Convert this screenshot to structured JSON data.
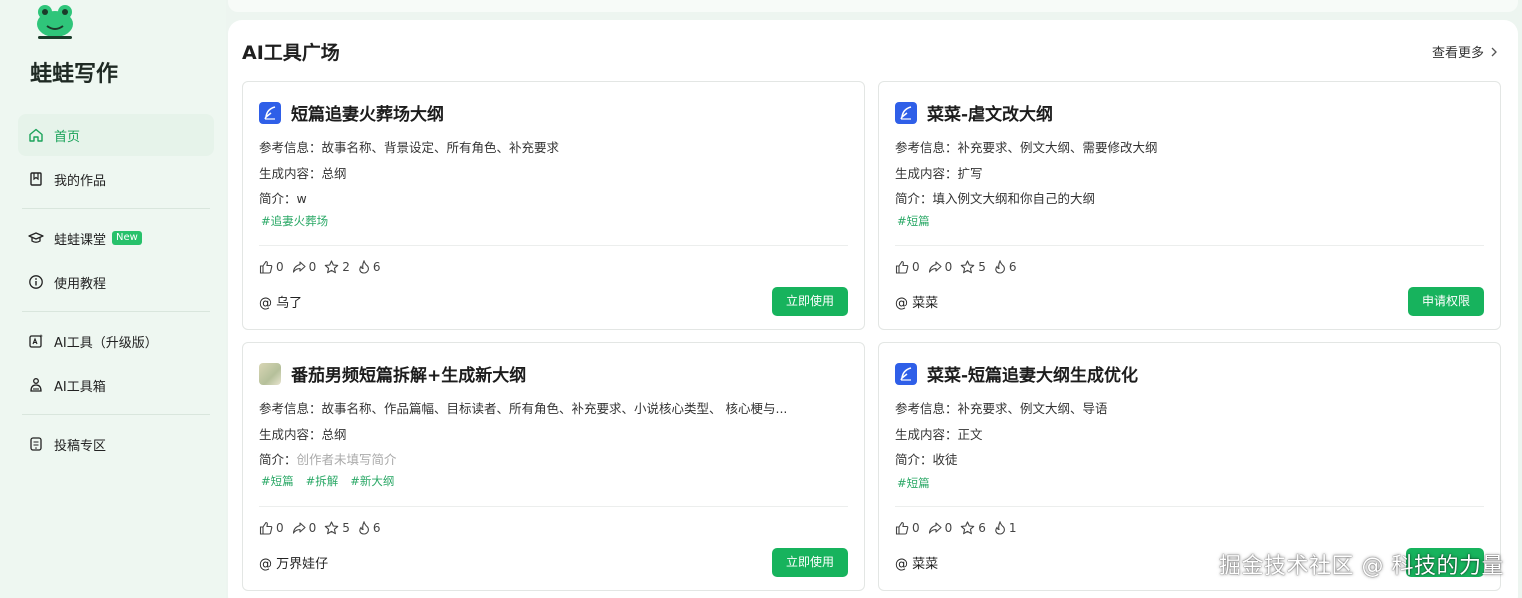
{
  "sidebar": {
    "brand": "蛙蛙写作",
    "items": [
      {
        "label": "首页",
        "active": true
      },
      {
        "label": "我的作品"
      },
      {
        "label": "蛙蛙课堂",
        "badge": "New"
      },
      {
        "label": "使用教程"
      },
      {
        "label": "AI工具（升级版）"
      },
      {
        "label": "AI工具箱"
      },
      {
        "label": "投稿专区"
      }
    ]
  },
  "main": {
    "title": "AI工具广场",
    "see_more": "查看更多"
  },
  "cards": [
    {
      "title": "短篇追妻火葬场大纲",
      "ref": "参考信息：故事名称、背景设定、所有角色、补充要求",
      "gen": "生成内容：总纲",
      "intro_label": "简介：",
      "intro": "w",
      "tags": [
        "#追妻火葬场"
      ],
      "likes": "0",
      "shares": "0",
      "stars": "2",
      "uses": "6",
      "author": "@ 乌了",
      "button": "立即使用"
    },
    {
      "title": "菜菜-虐文改大纲",
      "ref": "参考信息：补充要求、例文大纲、需要修改大纲",
      "gen": "生成内容：扩写",
      "intro_label": "简介：",
      "intro": "填入例文大纲和你自己的大纲",
      "tags": [
        "#短篇"
      ],
      "likes": "0",
      "shares": "0",
      "stars": "5",
      "uses": "6",
      "author": "@ 菜菜",
      "button": "申请权限"
    },
    {
      "title": "番茄男频短篇拆解+生成新大纲",
      "ref": "参考信息：故事名称、作品篇幅、目标读者、所有角色、补充要求、小说核心类型、 核心梗与...",
      "gen": "生成内容：总纲",
      "intro_label": "简介：",
      "intro": "创作者未填写简介",
      "tags": [
        "#短篇",
        "#拆解",
        "#新大纲"
      ],
      "likes": "0",
      "shares": "0",
      "stars": "5",
      "uses": "6",
      "author": "@ 万界娃仔",
      "button": "立即使用"
    },
    {
      "title": "菜菜-短篇追妻大纲生成优化",
      "ref": "参考信息：补充要求、例文大纲、导语",
      "gen": "生成内容：正文",
      "intro_label": "简介：",
      "intro": "收徒",
      "tags": [
        "#短篇"
      ],
      "likes": "0",
      "shares": "0",
      "stars": "6",
      "uses": "1",
      "author": "@ 菜菜",
      "button": ""
    }
  ],
  "watermark": "掘金技术社区 @ 科技的力量",
  "colors": {
    "accent": "#17b35d",
    "icon_blue": "#2f5fe8",
    "tag": "#2aa866"
  }
}
